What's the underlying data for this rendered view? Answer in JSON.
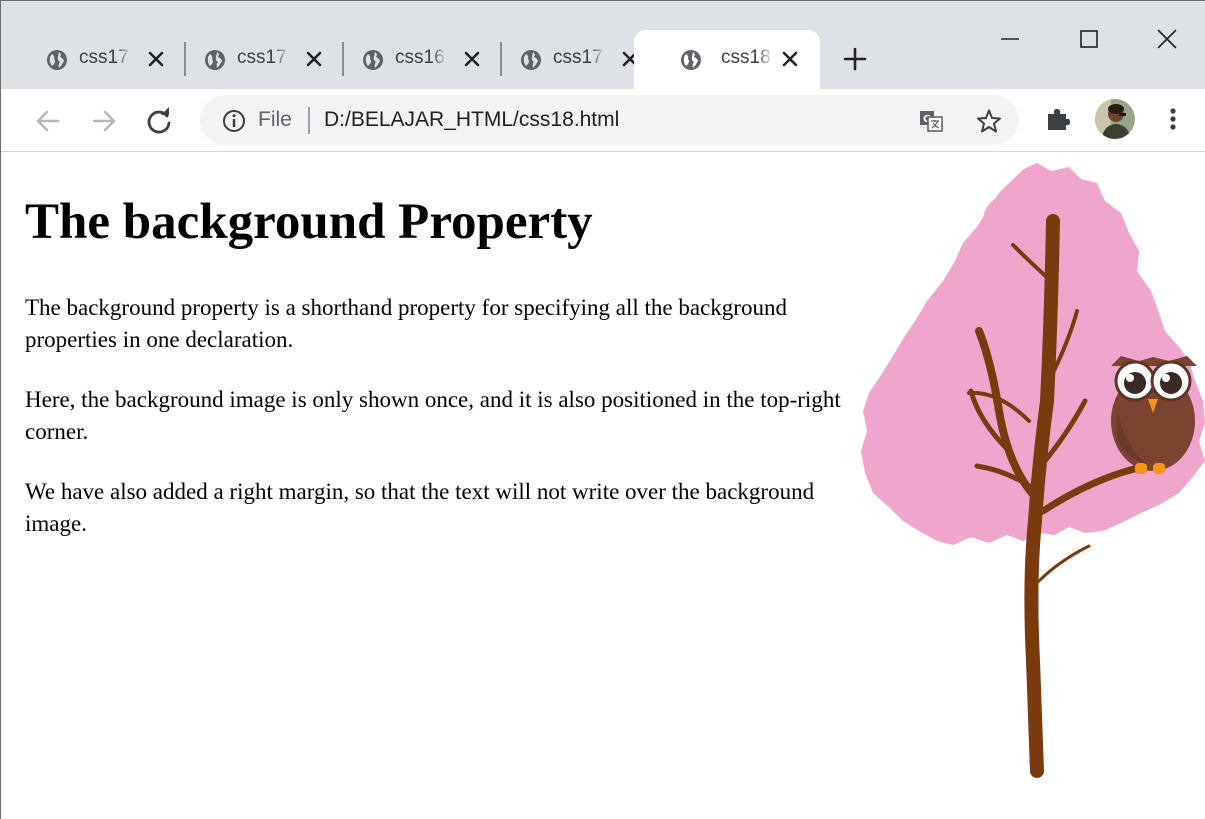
{
  "browser": {
    "tabs": [
      {
        "title": "css17"
      },
      {
        "title": "css17"
      },
      {
        "title": "css16"
      },
      {
        "title": "css17"
      },
      {
        "title": "css18",
        "active": true
      }
    ],
    "address": {
      "scheme_label": "File",
      "url": "D:/BELAJAR_HTML/css18.html"
    },
    "icons": {
      "favicon": "globe-icon",
      "tab_close": "close-icon",
      "new_tab": "plus-icon",
      "minimize": "minimize-icon",
      "maximize": "maximize-icon",
      "window_close": "close-icon",
      "back": "back-arrow-icon",
      "forward": "forward-arrow-icon",
      "reload": "reload-icon",
      "info": "info-icon",
      "translate": "translate-icon",
      "bookmark": "star-icon",
      "extensions": "puzzle-icon",
      "menu": "kebab-menu-icon"
    },
    "colors": {
      "tabstrip": "#dee1e6",
      "omnibox": "#f1f3f4",
      "icon": "#5f6368"
    }
  },
  "page": {
    "heading": "The background Property",
    "paragraphs": [
      "The background property is a shorthand property for specifying all the background properties in one declaration.",
      "Here, the background image is only shown once, and it is also positioned in the top-right corner.",
      "We have also added a right margin, so that the text will not write over the background image."
    ],
    "background_image": {
      "description_icon": "tree-with-owl-image",
      "colors": {
        "foliage": "#f0a6cc",
        "trunk": "#7a3a0e",
        "owl": "#7a4430",
        "beak_feet": "#f7931e"
      }
    }
  }
}
